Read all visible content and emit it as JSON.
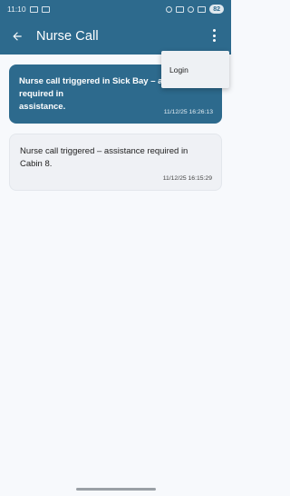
{
  "status_bar": {
    "time": "11:10",
    "battery": "82"
  },
  "toolbar": {
    "title": "Nurse Call"
  },
  "menu": {
    "items": [
      {
        "label": "Login"
      }
    ]
  },
  "calls": [
    {
      "message": "Nurse call triggered in Sick Bay – assistance required in",
      "message_tail": "assistance.",
      "timestamp": "11/12/25 16:26:13"
    },
    {
      "message": "Nurse call triggered – assistance required in Cabin 8.",
      "timestamp": "11/12/25 16:15:29"
    }
  ],
  "colors": {
    "primary": "#2d6a8d",
    "background": "#f7f9fc",
    "card": "#eff1f5"
  },
  "icons": {
    "back": "arrow-left-icon",
    "menu": "more-vert-icon"
  }
}
